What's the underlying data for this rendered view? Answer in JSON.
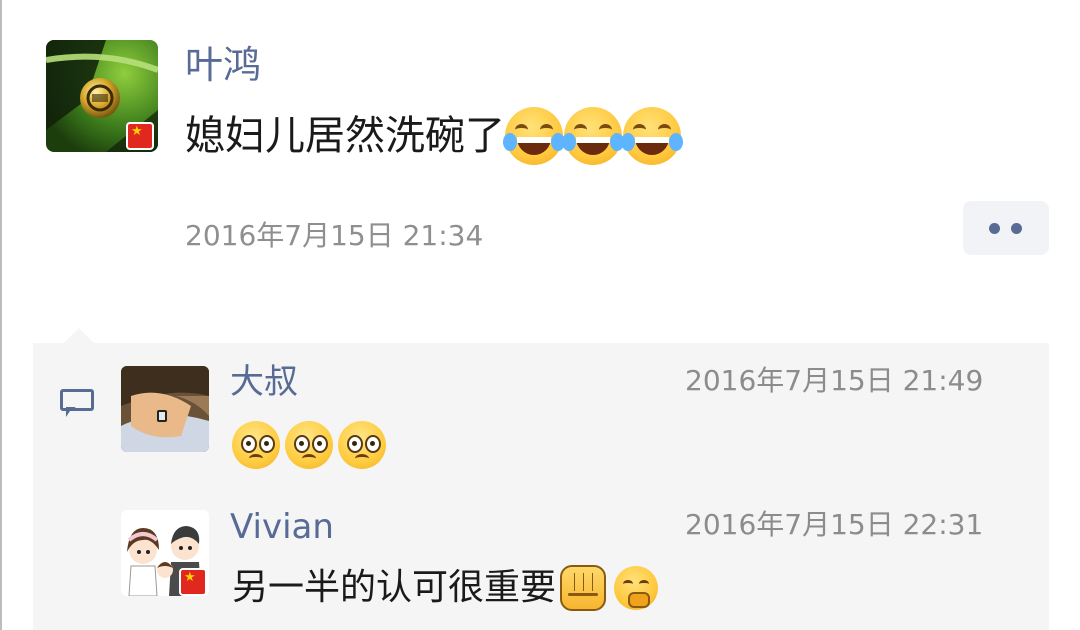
{
  "post": {
    "author": "叶鸿",
    "text": "媳妇儿居然洗碗了",
    "emojis": [
      "laugh-cry-emoji",
      "laugh-cry-emoji",
      "laugh-cry-emoji"
    ],
    "time": "2016年7月15日 21:34"
  },
  "comments": [
    {
      "author": "大叔",
      "time": "2016年7月15日 21:49",
      "text": "",
      "emojis": [
        "worried-face-emoji",
        "worried-face-emoji",
        "worried-face-emoji"
      ]
    },
    {
      "author": "Vivian",
      "time": "2016年7月15日 22:31",
      "text": "另一半的认可很重要",
      "emojis": [
        "fist-emoji",
        "thinking-face-emoji"
      ]
    }
  ],
  "colors": {
    "link_blue": "#576b95",
    "panel_bg": "#f5f5f5",
    "meta_gray": "#8f8f8f",
    "flag_red": "#e0281f"
  }
}
